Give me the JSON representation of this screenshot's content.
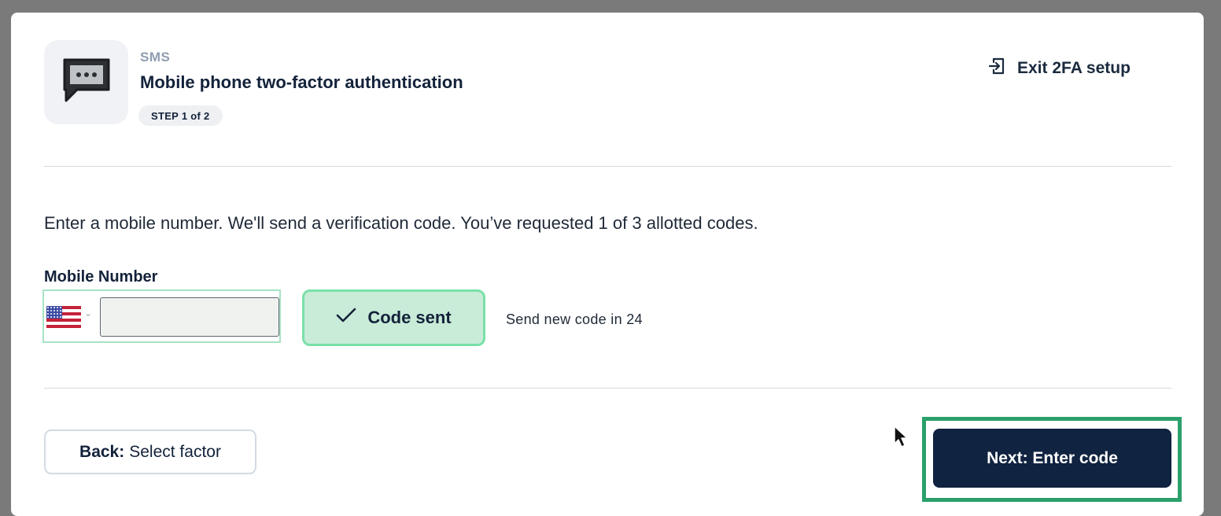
{
  "header": {
    "eyebrow": "SMS",
    "title": "Mobile phone two-factor authentication",
    "step": "STEP 1 of 2",
    "exit_label": "Exit 2FA setup",
    "factor_icon": "chat-bubble-icon",
    "exit_icon": "exit-icon"
  },
  "body": {
    "intro": "Enter a mobile number. We'll send a verification code. You’ve requested 1 of 3 allotted codes.",
    "field_label": "Mobile Number",
    "country_flag": "us-flag-icon",
    "code_sent_label": "Code sent",
    "resend_text": "Send new code in 24"
  },
  "footer": {
    "back_bold": "Back:",
    "back_rest": "Select factor",
    "next_label": "Next: Enter code"
  },
  "colors": {
    "primary_button": "#102340",
    "success_bg": "#c9ecd9",
    "success_border": "#79e0a8",
    "highlight_box": "#2aa06a"
  }
}
